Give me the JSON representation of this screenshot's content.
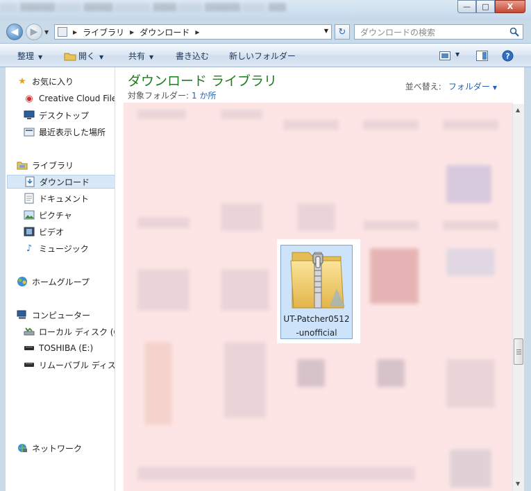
{
  "window": {
    "min": "—",
    "max": "□",
    "close": "X"
  },
  "address": {
    "crumbs": [
      "ライブラリ",
      "ダウンロード"
    ]
  },
  "search": {
    "placeholder": "ダウンロードの検索"
  },
  "toolbar": {
    "organize": "整理",
    "open": "開く",
    "share": "共有",
    "burn": "書き込む",
    "new_folder": "新しいフォルダー"
  },
  "nav": {
    "favorites": "お気に入り",
    "favorites_items": [
      "Creative Cloud Files",
      "デスクトップ",
      "最近表示した場所"
    ],
    "libraries": "ライブラリ",
    "libraries_items": [
      "ダウンロード",
      "ドキュメント",
      "ピクチャ",
      "ビデオ",
      "ミュージック"
    ],
    "homegroup": "ホームグループ",
    "computer": "コンピューター",
    "computer_items": [
      "ローカル ディスク (C:)",
      "TOSHIBA (E:)",
      "リムーバブル ディスク"
    ],
    "network": "ネットワーク"
  },
  "library": {
    "title": "ダウンロード ライブラリ",
    "subtitle_label": "対象フォルダー:",
    "subtitle_link": "1 か所",
    "sort_label": "並べ替え:",
    "sort_value": "フォルダー"
  },
  "selected_file": {
    "name_line1": "UT-Patcher0512",
    "name_line2": "-unofficial",
    "icon": "zip-folder-icon"
  },
  "colors": {
    "accent": "#1e7d1e",
    "link": "#1d64b8",
    "selection": "#cde3fa",
    "content_tint": "#fde5e5"
  }
}
